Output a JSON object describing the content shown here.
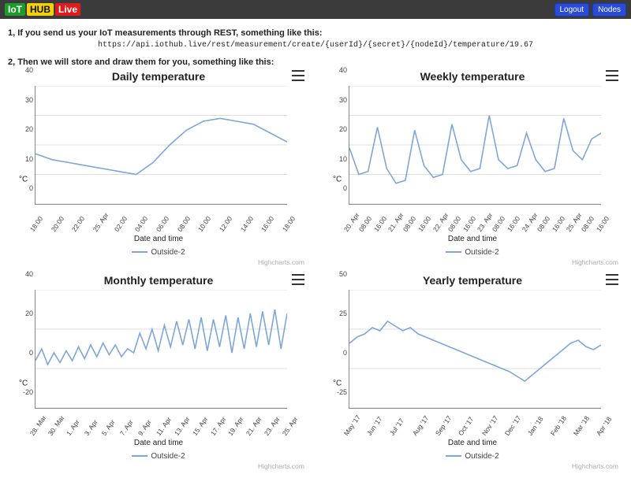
{
  "brand": {
    "p1": "IoT",
    "p2": "HUB",
    "p3": "Live"
  },
  "nav": {
    "logout": "Logout",
    "nodes": "Nodes"
  },
  "intro": {
    "line1": "1, If you send us your IoT measurements through REST, something like this:",
    "api": "https://api.iothub.live/rest/measurement/create/{userId}/{secret}/{nodeId}/temperature/19.67",
    "line2": "2, Then we will store and draw them for you, something like this:"
  },
  "common": {
    "xlabel": "Date and time",
    "ylabel": "°C",
    "legend": "Outside-2",
    "credit": "Highcharts.com"
  },
  "chart_data": [
    {
      "id": "daily",
      "type": "line",
      "title": "Daily temperature",
      "ylim": [
        0,
        40
      ],
      "yticks": [
        0,
        10,
        20,
        30,
        40
      ],
      "xlabels": [
        "18:00",
        "20:00",
        "22:00",
        "25. Apr",
        "02:00",
        "04:00",
        "06:00",
        "08:00",
        "10:00",
        "12:00",
        "14:00",
        "16:00",
        "18:00"
      ],
      "series": [
        {
          "name": "Outside-2",
          "values": [
            17,
            15,
            14,
            13,
            12,
            11,
            10,
            14,
            20,
            25,
            28,
            29,
            28,
            27,
            24,
            21
          ]
        }
      ]
    },
    {
      "id": "weekly",
      "type": "line",
      "title": "Weekly temperature",
      "ylim": [
        0,
        40
      ],
      "yticks": [
        0,
        10,
        20,
        30,
        40
      ],
      "xlabels": [
        "20. Apr",
        "08:00",
        "16:00",
        "21. Apr",
        "08:00",
        "16:00",
        "22. Apr",
        "08:00",
        "16:00",
        "23. Apr",
        "08:00",
        "16:00",
        "24. Apr",
        "08:00",
        "16:00",
        "25. Apr",
        "08:00",
        "16:00"
      ],
      "series": [
        {
          "name": "Outside-2",
          "values": [
            19,
            10,
            11,
            26,
            12,
            7,
            8,
            25,
            13,
            9,
            10,
            27,
            15,
            11,
            12,
            30,
            15,
            12,
            13,
            24,
            15,
            11,
            12,
            29,
            18,
            15,
            22,
            24
          ]
        }
      ]
    },
    {
      "id": "monthly",
      "type": "line",
      "title": "Monthly temperature",
      "ylim": [
        -20,
        40
      ],
      "yticks": [
        -20,
        0,
        20,
        40
      ],
      "xlabels": [
        "28. Mar",
        "30. Mar",
        "1. Apr",
        "3. Apr",
        "5. Apr",
        "7. Apr",
        "9. Apr",
        "11. Apr",
        "13. Apr",
        "15. Apr",
        "17. Apr",
        "19. Apr",
        "21. Apr",
        "23. Apr",
        "25. Apr"
      ],
      "series": [
        {
          "name": "Outside-2",
          "values": [
            4,
            10,
            2,
            8,
            3,
            9,
            4,
            11,
            5,
            12,
            6,
            13,
            7,
            12,
            6,
            10,
            8,
            18,
            10,
            20,
            9,
            22,
            11,
            24,
            12,
            25,
            10,
            26,
            9,
            25,
            11,
            27,
            8,
            26,
            10,
            28,
            11,
            29,
            12,
            30,
            10,
            28
          ]
        }
      ]
    },
    {
      "id": "yearly",
      "type": "line",
      "title": "Yearly temperature",
      "ylim": [
        -25,
        50
      ],
      "yticks": [
        -25,
        0,
        25,
        50
      ],
      "xlabels": [
        "May '17",
        "Jun '17",
        "Jul '17",
        "Aug '17",
        "Sep '17",
        "Oct '17",
        "Nov '17",
        "Dec '17",
        "Jan '18",
        "Feb '18",
        "Mar '18",
        "Apr '18"
      ],
      "series": [
        {
          "name": "Outside-2",
          "values": [
            16,
            20,
            22,
            26,
            24,
            30,
            27,
            24,
            26,
            22,
            20,
            18,
            16,
            14,
            12,
            10,
            8,
            6,
            4,
            2,
            0,
            -2,
            -5,
            -8,
            -4,
            0,
            4,
            8,
            12,
            16,
            18,
            14,
            12,
            15
          ]
        }
      ]
    }
  ]
}
